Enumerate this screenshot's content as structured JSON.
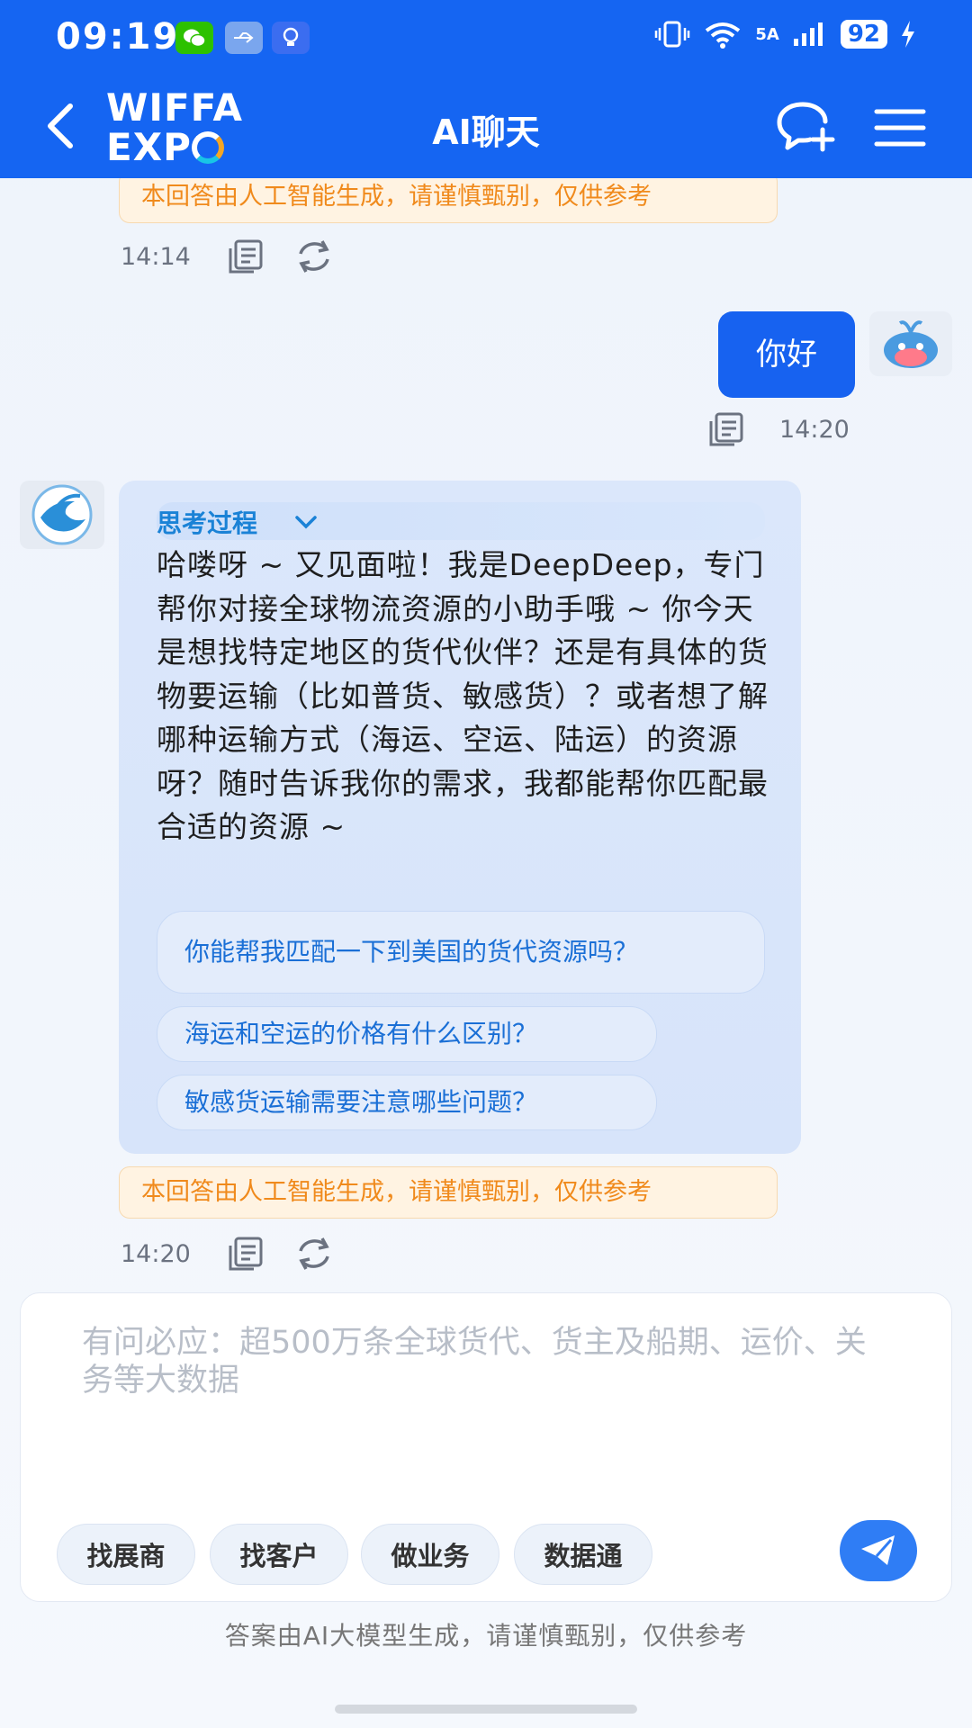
{
  "status_bar": {
    "time": "09:19",
    "network": "5A",
    "signal": "6",
    "battery": "92"
  },
  "nav": {
    "logo_line1": "WIFFA",
    "logo_line2": "EXP",
    "title": "AI聊天"
  },
  "chat": {
    "prev_disclaimer": "本回答由人工智能生成，请谨慎甄别，仅供参考",
    "prev_time": "14:14",
    "user_message": "你好",
    "user_time": "14:20",
    "thinking_label": "思考过程",
    "bot_message": "哈喽呀 ~ 又见面啦！我是DeepDeep，专门帮你对接全球物流资源的小助手哦 ~ 你今天是想找特定地区的货代伙伴？还是有具体的货物要运输（比如普货、敏感货）？或者想了解哪种运输方式（海运、空运、陆运）的资源呀？随时告诉我你的需求，我都能帮你匹配最合适的资源 ~",
    "suggestions": [
      "你能帮我匹配一下到美国的货代资源吗？",
      "海运和空运的价格有什么区别？",
      "敏感货运输需要注意哪些问题？"
    ],
    "bot_disclaimer": "本回答由人工智能生成，请谨慎甄别，仅供参考",
    "bot_time": "14:20"
  },
  "input": {
    "placeholder": "有问必应：超500万条全球货代、货主及船期、运价、关务等大数据",
    "chips": [
      "找展商",
      "找客户",
      "做业务",
      "数据通"
    ]
  },
  "footer_note": "答案由AI大模型生成，请谨慎甄别，仅供参考",
  "colors": {
    "primary": "#1565f2",
    "user_bubble": "#1762f0",
    "disclaimer_text": "#f08a1c",
    "suggestion_text": "#1a6fd6"
  }
}
